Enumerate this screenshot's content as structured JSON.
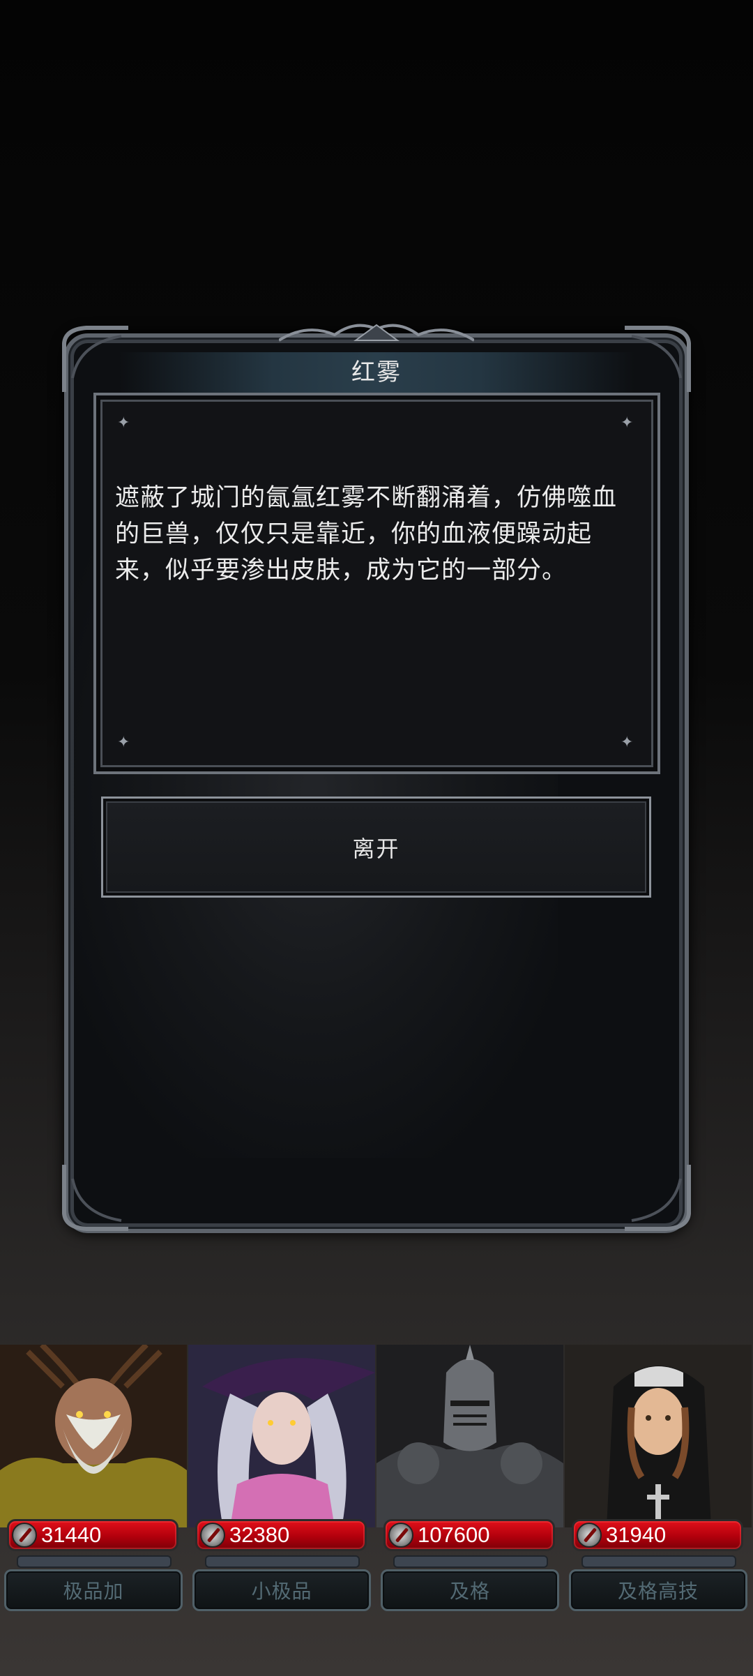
{
  "dialog": {
    "title": "红雾",
    "story": "遮蔽了城门的氤氲红雾不断翻涌着，仿佛噬血的巨兽，仅仅只是靠近，你的血液便躁动起来，似乎要渗出皮肤，成为它的一部分。",
    "leave_label": "离开"
  },
  "party": [
    {
      "power": "31440",
      "grade": "极品加",
      "portrait": "druid-elder",
      "icon": "sword-power-icon"
    },
    {
      "power": "32380",
      "grade": "小极品",
      "portrait": "purple-witch",
      "icon": "sword-power-icon"
    },
    {
      "power": "107600",
      "grade": "及格",
      "portrait": "armored-knight",
      "icon": "sword-power-icon"
    },
    {
      "power": "31940",
      "grade": "及格高技",
      "portrait": "nun-warrior",
      "icon": "sword-power-icon"
    }
  ],
  "colors": {
    "power_bar": "#c8000f",
    "grade_text": "#536a74",
    "frame": "#5e646c"
  }
}
